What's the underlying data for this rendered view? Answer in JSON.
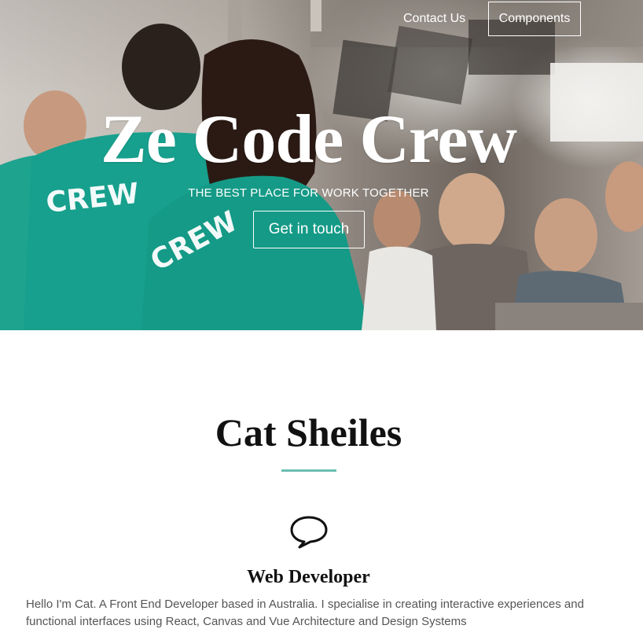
{
  "nav": {
    "contact_label": "Contact Us",
    "components_label": "Components"
  },
  "hero": {
    "title": "Ze Code Crew",
    "subtitle": "THE BEST PLACE FOR WORK TOGETHER",
    "cta_label": "Get in touch",
    "photo_shirt_text": "CREW"
  },
  "profile": {
    "name": "Cat Sheiles",
    "role_icon": "speech-bubble-icon",
    "role": "Web Developer",
    "bio": "Hello I'm Cat. A Front End Developer based in Australia. I specialise in creating interactive experiences and functional interfaces using React, Canvas and Vue Architecture and Design Systems"
  },
  "colors": {
    "accent": "#6bbfb1",
    "shirt": "#1ea38f",
    "text": "#111111",
    "muted_text": "#555555"
  }
}
